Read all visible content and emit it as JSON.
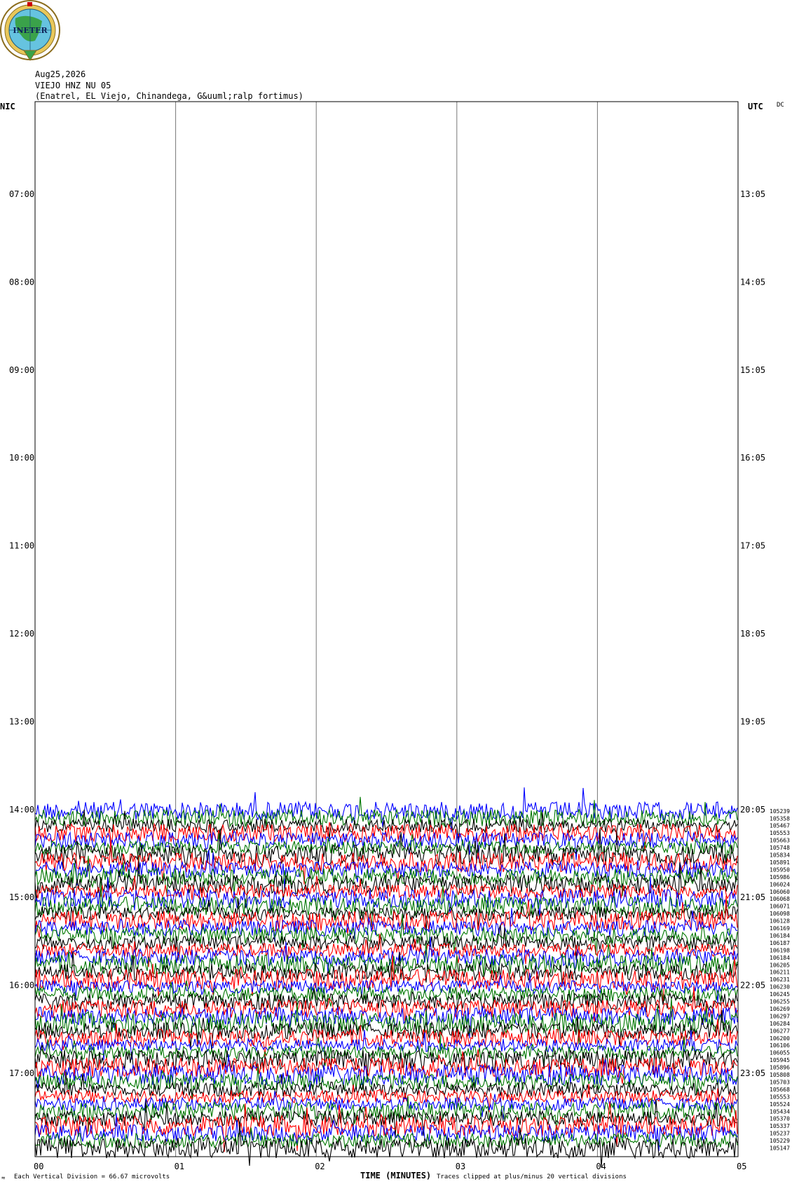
{
  "logo": {
    "text": "INETER",
    "icon": "ineter-globe-logo"
  },
  "header": {
    "date": "Aug25,2026",
    "station": "VIEJO HNZ NU 05",
    "location": "(Enatrel, EL Viejo, Chinandega, G&uuml;ralp fortimus)",
    "left_zone": "NIC",
    "right_zone": "UTC",
    "dc_label": "DC"
  },
  "footer": {
    "scale_note": "Each Vertical Division =   66.67 microvolts",
    "axis_title": "TIME (MINUTES)",
    "clip_note": "Traces clipped at plus/minus 20 vertical divisions"
  },
  "chart_data": {
    "type": "line",
    "title": "VIEJO HNZ NU 05",
    "xlabel": "TIME (MINUTES)",
    "xlim": [
      0,
      5
    ],
    "x_ticks": [
      "00",
      "01",
      "02",
      "03",
      "04",
      "05"
    ],
    "y_ticks_left": [
      "07:00",
      "08:00",
      "09:00",
      "10:00",
      "11:00",
      "12:00",
      "13:00",
      "14:00",
      "15:00",
      "16:00",
      "17:00"
    ],
    "y_ticks_right": [
      "13:05",
      "14:05",
      "15:05",
      "16:05",
      "17:05",
      "18:05",
      "19:05",
      "20:05",
      "21:05",
      "22:05",
      "23:05"
    ],
    "trace_colors": [
      "#0000ff",
      "#007700",
      "#000000",
      "#ff0000"
    ],
    "grid": true,
    "first_trace_hour": 14.0,
    "trace_interval_minutes": 5,
    "trace_counts": [
      "105239",
      "105358",
      "105467",
      "105553",
      "105663",
      "105748",
      "105834",
      "105891",
      "105950",
      "105986",
      "106024",
      "106060",
      "106068",
      "106071",
      "106098",
      "106128",
      "106169",
      "106184",
      "106187",
      "106198",
      "106184",
      "106205",
      "106211",
      "106231",
      "106230",
      "106245",
      "106255",
      "106269",
      "106297",
      "106284",
      "106277",
      "106200",
      "106106",
      "106055",
      "105945",
      "105896",
      "105808",
      "105703",
      "105668",
      "105553",
      "105524",
      "105434",
      "105370",
      "105337",
      "105237",
      "105229",
      "105147"
    ]
  }
}
